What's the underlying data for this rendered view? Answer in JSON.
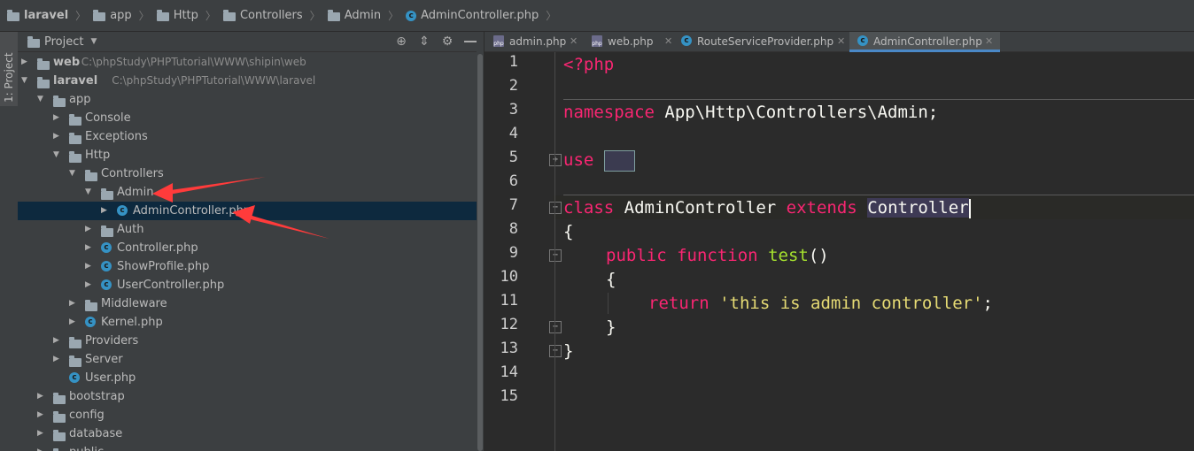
{
  "breadcrumb": [
    "laravel",
    "app",
    "Http",
    "Controllers",
    "Admin",
    "AdminController.php"
  ],
  "sidebar_tab": "1: Project",
  "panel": {
    "title": "Project"
  },
  "tree": [
    {
      "label": "web",
      "path": "C:\\phpStudy\\PHPTutorial\\WWW\\shipin\\web",
      "icon": "folder",
      "bold": true,
      "level": 0,
      "expanded": false,
      "selected": false
    },
    {
      "label": "laravel",
      "path": "C:\\phpStudy\\PHPTutorial\\WWW\\laravel",
      "icon": "folder",
      "bold": true,
      "level": 0,
      "expanded": true,
      "selected": false
    },
    {
      "label": "app",
      "icon": "folder",
      "level": 1,
      "expanded": true
    },
    {
      "label": "Console",
      "icon": "folder",
      "level": 2,
      "expanded": false
    },
    {
      "label": "Exceptions",
      "icon": "folder",
      "level": 2,
      "expanded": false
    },
    {
      "label": "Http",
      "icon": "folder",
      "level": 2,
      "expanded": true
    },
    {
      "label": "Controllers",
      "icon": "folder",
      "level": 3,
      "expanded": true
    },
    {
      "label": "Admin",
      "icon": "folder",
      "level": 4,
      "expanded": true
    },
    {
      "label": "AdminController.php",
      "icon": "class",
      "level": 5,
      "expanded": false,
      "selected": true
    },
    {
      "label": "Auth",
      "icon": "folder",
      "level": 4,
      "expanded": false
    },
    {
      "label": "Controller.php",
      "icon": "class",
      "level": 4,
      "expanded": false
    },
    {
      "label": "ShowProfile.php",
      "icon": "class",
      "level": 4,
      "expanded": false
    },
    {
      "label": "UserController.php",
      "icon": "class",
      "level": 4,
      "expanded": false
    },
    {
      "label": "Middleware",
      "icon": "folder",
      "level": 3,
      "expanded": false
    },
    {
      "label": "Kernel.php",
      "icon": "class",
      "level": 3,
      "expanded": false
    },
    {
      "label": "Providers",
      "icon": "folder",
      "level": 2,
      "expanded": false
    },
    {
      "label": "Server",
      "icon": "folder",
      "level": 2,
      "expanded": false
    },
    {
      "label": "User.php",
      "icon": "class",
      "level": 2,
      "expanded": null
    },
    {
      "label": "bootstrap",
      "icon": "folder",
      "level": 1,
      "expanded": false
    },
    {
      "label": "config",
      "icon": "folder",
      "level": 1,
      "expanded": false
    },
    {
      "label": "database",
      "icon": "folder",
      "level": 1,
      "expanded": false
    },
    {
      "label": "public",
      "icon": "folder",
      "level": 1,
      "expanded": false
    }
  ],
  "tabs": [
    {
      "label": "admin.php",
      "icon": "php-file-icon",
      "active": false
    },
    {
      "label": "web.php",
      "icon": "php-file-icon",
      "active": false
    },
    {
      "label": "RouteServiceProvider.php",
      "icon": "class-icon",
      "active": false
    },
    {
      "label": "AdminController.php",
      "icon": "class-icon",
      "active": true
    }
  ],
  "tab_close": "✕",
  "line_numbers": [
    "1",
    "2",
    "3",
    "4",
    "5",
    "6",
    "7",
    "8",
    "9",
    "10",
    "11",
    "12",
    "13",
    "14",
    "15"
  ],
  "code": {
    "l1": "<?php",
    "l3_kw": "namespace",
    "l3_rest": " App\\Http\\Controllers\\Admin;",
    "l5_kw": "use",
    "l8_kw1": "class",
    "l8_name": " AdminController ",
    "l8_kw2": "extends",
    "l8_parent": "Controller",
    "l9": "{",
    "l10_kw1": "public",
    "l10_kw2": "function",
    "l10_fn": "test",
    "l10_rest": "()",
    "l11": "{",
    "l12_kw": "return",
    "l12_str": "'this is admin controller'",
    "l12_end": ";",
    "l13": "}",
    "l14": "}"
  },
  "colors": {
    "keyword": "#f92672",
    "string": "#e6db74",
    "function": "#a6e22e",
    "annotation_arrow": "#ff3b3b"
  }
}
